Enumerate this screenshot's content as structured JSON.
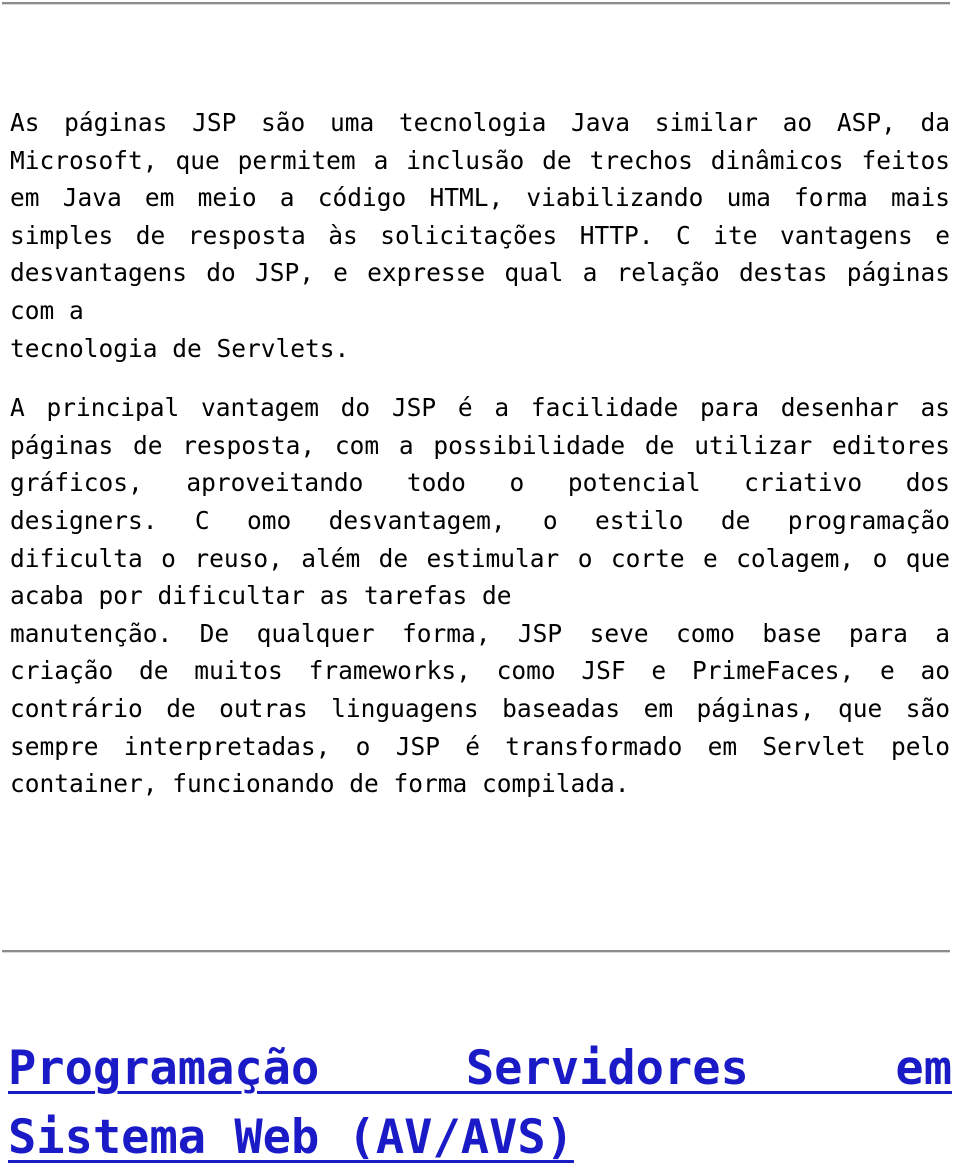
{
  "document": {
    "background_color": "#ffffff",
    "text_color": "#000000",
    "rules": {
      "top_rule": "horizontal-rule",
      "middle_rule": "horizontal-rule",
      "color": "#8c8c8c"
    },
    "body": {
      "paragraphs": [
        {
          "id": "paragraph-question",
          "lines": [
            "As páginas JSP são uma tecnologia Java similar ao ASP, da",
            "Microsoft, que permitem a inclusão de trechos dinâmicos feitos",
            "em Java em meio a código HTML, viabilizando uma forma mais",
            "simples de resposta às solicitações HTTP. C ite vantagens e",
            "desvantagens do JSP, e expresse qual a relação destas páginas",
            "com a",
            "tecnologia de Servlets."
          ],
          "ragged_lines": [
            5,
            6
          ]
        },
        {
          "id": "paragraph-answer",
          "lines": [
            "A principal vantagem do JSP é a facilidade para desenhar as",
            "páginas de resposta, com a possibilidade de utilizar editores",
            "gráficos, aproveitando todo o potencial criativo dos",
            "designers. C omo desvantagem, o estilo de programação",
            "dificulta o reuso, além de estimular o corte e colagem, o que",
            "acaba por dificultar as tarefas de",
            "manutenção. De qualquer forma, JSP seve como base para a",
            "criação de muitos frameworks, como JSF e PrimeFaces, e ao",
            "contrário de outras linguagens baseadas em páginas, que são",
            "sempre interpretadas, o JSP é transformado em Servlet pelo",
            "container, funcionando de forma compilada."
          ],
          "ragged_lines": [
            5,
            10
          ]
        }
      ]
    },
    "heading": {
      "id": "section-heading",
      "color": "#1a1ac6",
      "underlined": true,
      "bold": true,
      "lines": [
        "Programação Servidores em",
        "Sistema Web (AV/AVS)"
      ],
      "ragged_lines": [
        1
      ],
      "full_text": "Programação Servidores em Sistema Web (AV/AVS)"
    }
  }
}
